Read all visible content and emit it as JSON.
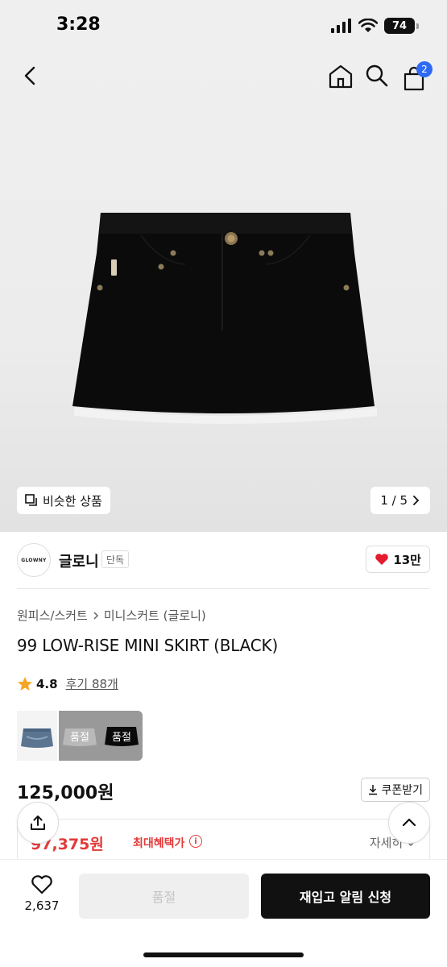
{
  "status_bar": {
    "time": "3:28",
    "battery": "74"
  },
  "nav": {
    "cart_count": "2"
  },
  "hero": {
    "similar_label": "비슷한 상품",
    "page_indicator": "1 / 5"
  },
  "brand": {
    "logo_text": "GLOWNY",
    "name": "글로니",
    "tag": "단독",
    "likes": "13만"
  },
  "breadcrumb": {
    "category": "원피스/스커트",
    "subcategory": "미니스커트 (글로니)"
  },
  "product": {
    "title": "99 LOW-RISE MINI SKIRT (BLACK)",
    "rating": "4.8",
    "review_label": "후기 88개",
    "price": "125,000원",
    "coupon_label": "쿠폰받기"
  },
  "thumbnails": {
    "sold_out_1": "품절",
    "sold_out_2": "품절"
  },
  "benefit": {
    "price": "97,375원",
    "label": "최대혜택가",
    "detail": "자세히"
  },
  "bottom": {
    "wish_count": "2,637",
    "sold_out_label": "품절",
    "restock_label": "재입고 알림 신청"
  },
  "colors": {
    "accent_red": "#e23a3a",
    "heart_red": "#e51b2e",
    "badge_blue": "#2f6af5",
    "star": "#f5a623"
  }
}
